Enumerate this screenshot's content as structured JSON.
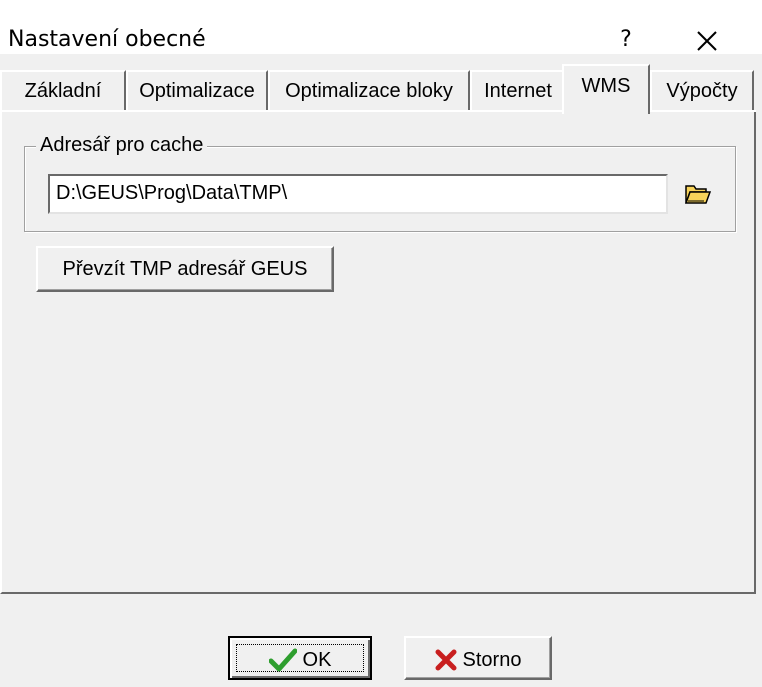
{
  "window": {
    "title": "Nastavení obecné",
    "help_label": "?",
    "close_icon": "close-icon"
  },
  "tabs": [
    {
      "label": "Základní",
      "active": false
    },
    {
      "label": "Optimalizace",
      "active": false
    },
    {
      "label": "Optimalizace bloky",
      "active": false
    },
    {
      "label": "Internet",
      "active": false
    },
    {
      "label": "WMS",
      "active": true
    },
    {
      "label": "Výpočty",
      "active": false
    }
  ],
  "wms": {
    "cache_group_label": "Adresář pro cache",
    "cache_path": "D:\\GEUS\\Prog\\Data\\TMP\\",
    "browse_icon": "folder-open-icon",
    "take_tmp_button": "Převzít TMP adresář GEUS"
  },
  "footer": {
    "ok_label": "OK",
    "ok_icon": "checkmark-icon",
    "cancel_label": "Storno",
    "cancel_icon": "x-mark-icon"
  },
  "colors": {
    "face": "#f0f0f0",
    "ok_check": "#2e9e2e",
    "cancel_x": "#c81e1e",
    "folder": "#f7d35a"
  }
}
